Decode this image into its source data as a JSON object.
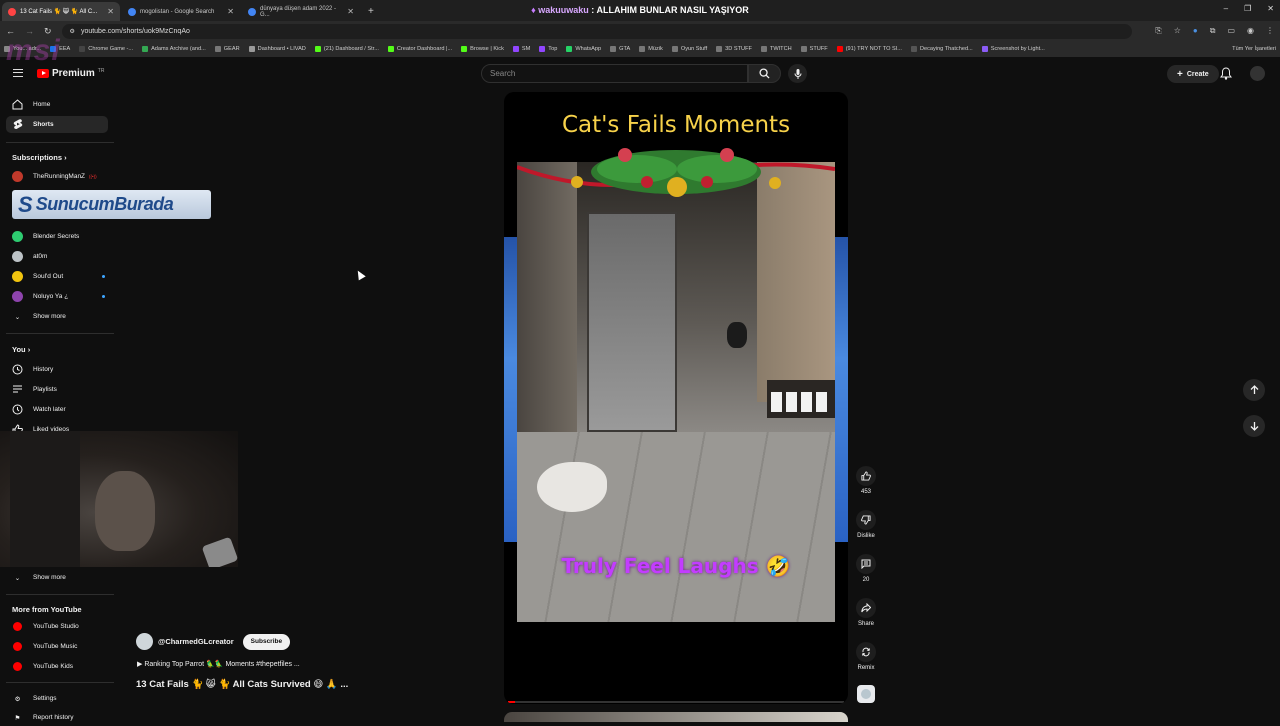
{
  "browser": {
    "window_title_prefix": "wakuuwaku",
    "window_title_rest": " : ALLAHIM BUNLAR NASIL YAŞIYOR",
    "tabs": [
      {
        "label": "13 Cat Fails 🐈 😸 🐈 All C...",
        "color": "#ff4444"
      },
      {
        "label": "mogolistan - Google Search",
        "color": "#4285f4"
      },
      {
        "label": "dünyaya düşen adam 2022 - G...",
        "color": "#4285f4"
      }
    ],
    "new_tab": "+",
    "window_controls": [
      "–",
      "❐",
      "✕"
    ],
    "url": "youtube.com/shorts/uok9MzCnqAo",
    "bookmarks": [
      {
        "label": "You... adr...",
        "color": "#888"
      },
      {
        "label": "EEA",
        "color": "#1a73e8"
      },
      {
        "label": "Chrome Game -...",
        "color": "#444"
      },
      {
        "label": "Adams Archive (and...",
        "color": "#34a853"
      },
      {
        "label": "GEAR",
        "color": "#777"
      },
      {
        "label": "Dashboard • LIVAD",
        "color": "#999"
      },
      {
        "label": "(21) Dashboard / Str...",
        "color": "#53fc18"
      },
      {
        "label": "Creator Dashboard |...",
        "color": "#53fc18"
      },
      {
        "label": "Browse | Kick",
        "color": "#53fc18"
      },
      {
        "label": "SM",
        "color": "#9146ff"
      },
      {
        "label": "Top",
        "color": "#9146ff"
      },
      {
        "label": "WhatsApp",
        "color": "#25d366"
      },
      {
        "label": "GTA",
        "color": "#777"
      },
      {
        "label": "Müzik",
        "color": "#777"
      },
      {
        "label": "Oyun Stuff",
        "color": "#777"
      },
      {
        "label": "3D STUFF",
        "color": "#777"
      },
      {
        "label": "TWITCH",
        "color": "#777"
      },
      {
        "label": "STUFF",
        "color": "#777"
      },
      {
        "label": "(91) TRY NOT TO SI...",
        "color": "#ff0000"
      },
      {
        "label": "Decaying Thatched...",
        "color": "#555"
      },
      {
        "label": "Screenshot by Light...",
        "color": "#8b5cf6"
      }
    ],
    "all_bookmarks": "Tüm Yer İşaretleri"
  },
  "overlay": {
    "msi": "msi",
    "banner_s": "S",
    "banner_text": "SunucumBurada"
  },
  "youtube": {
    "logo_text": "Premium",
    "logo_tm": "TR",
    "search_placeholder": "Search",
    "create_label": "Create",
    "sidebar": {
      "main": [
        {
          "label": "Home",
          "icon": "home-icon"
        },
        {
          "label": "Shorts",
          "icon": "shorts-icon",
          "active": true
        }
      ],
      "subscriptions_heading": "Subscriptions",
      "subscriptions": [
        {
          "label": "TheRunningManZ",
          "color": "#c0392b",
          "badge": "live"
        },
        {
          "label": "Blender Secrets",
          "color": "#2ecc71"
        },
        {
          "label": "at0m",
          "color": "#bdc3c7"
        },
        {
          "label": "Soul'd Out",
          "color": "#f1c40f"
        },
        {
          "label": "Noluyo Ya ¿",
          "color": "#8e44ad"
        }
      ],
      "show_more": "Show more",
      "you_heading": "You",
      "you": [
        {
          "label": "History",
          "icon": "history-icon"
        },
        {
          "label": "Playlists",
          "icon": "playlists-icon"
        },
        {
          "label": "Watch later",
          "icon": "watch-later-icon"
        },
        {
          "label": "Liked videos",
          "icon": "liked-icon"
        }
      ],
      "show_more_2": "Show more",
      "more_heading": "More from YouTube",
      "more": [
        {
          "label": "YouTube Studio"
        },
        {
          "label": "YouTube Music"
        },
        {
          "label": "YouTube Kids"
        }
      ],
      "settings": "Settings",
      "report_history": "Report history"
    },
    "short": {
      "title_overlay": "Cat's Fails Moments",
      "caption_overlay": "Truly Feel Laughs 🤣",
      "progress": 0.02,
      "channel": "@CharmedGLcreator",
      "subscribe_label": "Subscribe",
      "sound": "▶ Ranking Top Parrot 🦜🦜 Moments #thepetfiles ...",
      "title": "13 Cat Fails 🐈 😸 🐈 All Cats Survived 😄 🙏 ..."
    },
    "actions": {
      "like_count": "453",
      "dislike_label": "Dislike",
      "comments_count": "20",
      "share_label": "Share",
      "remix_label": "Remix"
    }
  }
}
